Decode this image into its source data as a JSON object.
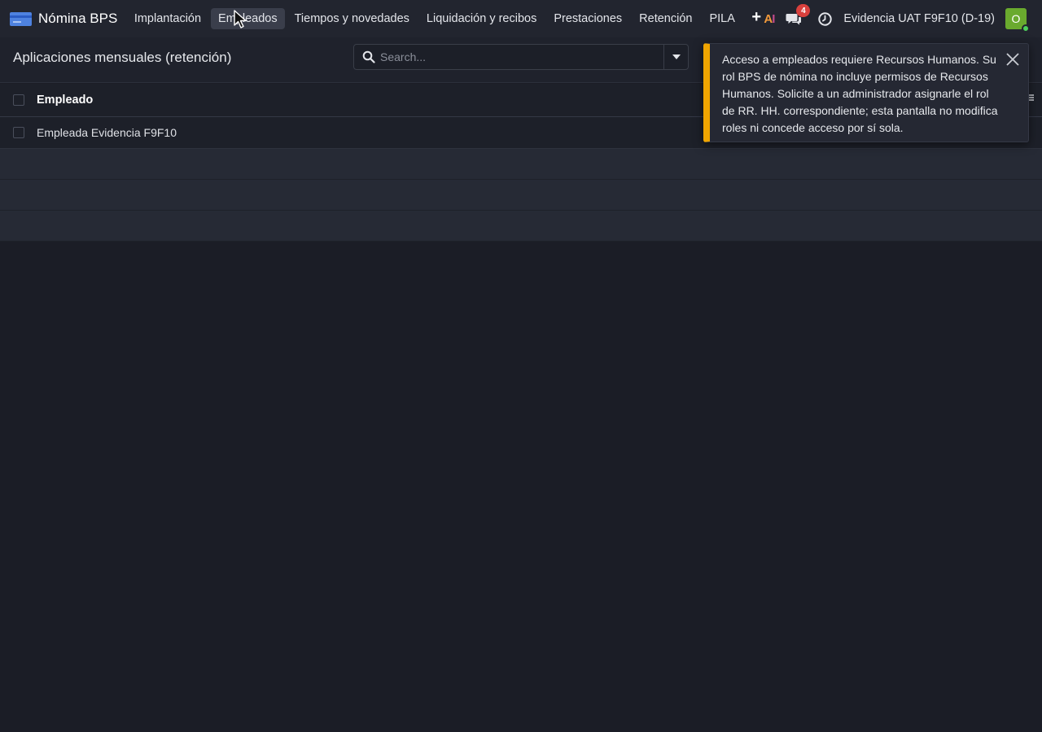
{
  "navbar": {
    "brand": "Nómina BPS",
    "menu": [
      {
        "label": "Implantación"
      },
      {
        "label": "Empleados"
      },
      {
        "label": "Tiempos y novedades"
      },
      {
        "label": "Liquidación y recibos"
      },
      {
        "label": "Prestaciones"
      },
      {
        "label": "Retención"
      },
      {
        "label": "PILA"
      }
    ],
    "active_menu": "Empleados",
    "plus": "+",
    "ai_icon": "AI",
    "messages_badge": "4",
    "company": "Evidencia UAT F9F10 (D-19)",
    "avatar_initial": "O",
    "icons": [
      "menu-app-icon",
      "plus-icon",
      "ai-icon",
      "chat-icon",
      "clock-icon",
      "avatar"
    ]
  },
  "control_panel": {
    "title": "Aplicaciones mensuales (retención)",
    "search_placeholder": "Search..."
  },
  "table": {
    "columns": [
      "Empleado"
    ],
    "rows": [
      {
        "employee": "Empleada Evidencia F9F10"
      }
    ]
  },
  "toast": {
    "message": "Acceso a empleados requiere Recursos Humanos. Su rol BPS de nómina no incluye permisos de Recursos Humanos. Solicite a un administrador asignarle el rol de RR. HH. correspondiente; esta pantalla no modifica roles ni concede acceso por sí sola.",
    "accent_color": "#f0a500"
  },
  "colors": {
    "background": "#1b1d26",
    "navbar": "#22252f",
    "badge": "#d9403d",
    "avatar": "#6aaa2e"
  }
}
